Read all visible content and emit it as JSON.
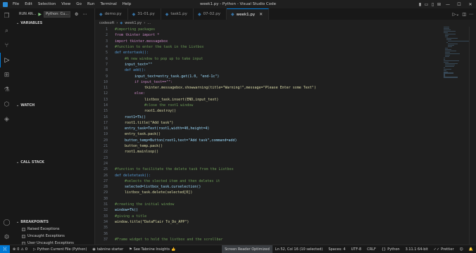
{
  "titlebar": {
    "title": "week1.py - Python - Visual Studio Code",
    "menu": [
      "File",
      "Edit",
      "Selection",
      "View",
      "Go",
      "Run",
      "Terminal",
      "Help"
    ],
    "min": "—",
    "max": "☐",
    "close": "✕"
  },
  "sidebar": {
    "run_label": "RUN AN...",
    "config": "Python: Cu...",
    "variables": "VARIABLES",
    "watch": "WATCH",
    "call_stack": "CALL STACK",
    "breakpoints": "BREAKPOINTS",
    "bp_items": [
      {
        "label": "Raised Exceptions"
      },
      {
        "label": "Uncaught Exceptions"
      },
      {
        "label": "User Uncaught Exceptions"
      }
    ]
  },
  "tabs": [
    {
      "label": "demo.py",
      "active": false
    },
    {
      "label": "31-01.py",
      "active": false
    },
    {
      "label": "task1.py",
      "active": false
    },
    {
      "label": "07-02.py",
      "active": false
    },
    {
      "label": "week1.py",
      "active": true
    }
  ],
  "breadcrumb": {
    "folder": "codesoft",
    "file": "week1.py",
    "tail": "..."
  },
  "code": [
    {
      "n": "1",
      "t": "#importing packages",
      "c": "comment",
      "i": 1
    },
    {
      "n": "2",
      "t": "from tkinter import *",
      "c": "kw",
      "i": 1
    },
    {
      "n": "3",
      "t": "import tkinter.messagebox",
      "c": "kw",
      "i": 1
    },
    {
      "n": "4",
      "t": "#function to enter the task in the Listbox",
      "c": "comment",
      "i": 1
    },
    {
      "n": "5",
      "t": "def entertask():",
      "c": "def",
      "i": 1
    },
    {
      "n": "6",
      "t": "#A new window to pop up to take input",
      "c": "comment",
      "i": 2
    },
    {
      "n": "7",
      "t": "input_text=\"\"",
      "c": "var",
      "i": 2
    },
    {
      "n": "8",
      "t": "def add():",
      "c": "def",
      "i": 2
    },
    {
      "n": "9",
      "t": "input_text=entry_task.get(1.0, \"end-1c\")",
      "c": "var",
      "i": 3
    },
    {
      "n": "10",
      "t": "if input_text==\"\":",
      "c": "kw",
      "i": 3
    },
    {
      "n": "11",
      "t": "tkinter.messagebox.showwarning(title=\"Warning!\",message=\"Please Enter some Text\")",
      "c": "call",
      "i": 4
    },
    {
      "n": "12",
      "t": "else:",
      "c": "kw",
      "i": 3
    },
    {
      "n": "13",
      "t": "listbox_task.insert(END,input_text)",
      "c": "call",
      "i": 4
    },
    {
      "n": "14",
      "t": "#close the root1 window",
      "c": "comment",
      "i": 4
    },
    {
      "n": "15",
      "t": "root1.destroy()",
      "c": "call",
      "i": 4
    },
    {
      "n": "16",
      "t": "root1=Tk()",
      "c": "var",
      "i": 2
    },
    {
      "n": "17",
      "t": "root1.title(\"Add task\")",
      "c": "call",
      "i": 2
    },
    {
      "n": "18",
      "t": "entry_task=Text(root1,width=40,height=4)",
      "c": "var",
      "i": 2
    },
    {
      "n": "19",
      "t": "entry_task.pack()",
      "c": "call",
      "i": 2
    },
    {
      "n": "20",
      "t": "button_temp=Button(root1,text=\"Add task\",command=add)",
      "c": "var",
      "i": 2
    },
    {
      "n": "21",
      "t": "button_temp.pack()",
      "c": "call",
      "i": 2
    },
    {
      "n": "22",
      "t": "root1.mainloop()",
      "c": "call",
      "i": 2
    },
    {
      "n": "23",
      "t": "",
      "c": "var",
      "i": 1
    },
    {
      "n": "24",
      "t": "",
      "c": "var",
      "i": 1
    },
    {
      "n": "25",
      "t": "#function to facilitate the delete task from the Listbox",
      "c": "comment",
      "i": 1
    },
    {
      "n": "26",
      "t": "def deletetask():",
      "c": "def",
      "i": 1
    },
    {
      "n": "27",
      "t": "#selects the slected item and then deletes it",
      "c": "comment",
      "i": 2
    },
    {
      "n": "28",
      "t": "selected=listbox_task.curselection()",
      "c": "var",
      "i": 2
    },
    {
      "n": "29",
      "t": "listbox_task.delete(selected[0])",
      "c": "call",
      "i": 2
    },
    {
      "n": "30",
      "t": "",
      "c": "var",
      "i": 1
    },
    {
      "n": "31",
      "t": "#creating the initial window",
      "c": "comment",
      "i": 1
    },
    {
      "n": "32",
      "t": "window=Tk()",
      "c": "var",
      "i": 1
    },
    {
      "n": "33",
      "t": "#giving a title",
      "c": "comment",
      "i": 1
    },
    {
      "n": "34",
      "t": "window.title(\"DataFlair To_Do_APP\")",
      "c": "call",
      "i": 1
    },
    {
      "n": "35",
      "t": "",
      "c": "var",
      "i": 1
    },
    {
      "n": "36",
      "t": "",
      "c": "var",
      "i": 1
    },
    {
      "n": "37",
      "t": "#Frame widget to hold the listbox and the scrollbar",
      "c": "comment",
      "i": 1
    }
  ],
  "status": {
    "interpreter": "Python Current File (Python)",
    "tabnine": "tabnine starter",
    "insights": "See Tabnine Insights",
    "screen_reader": "Screen Reader Optimized",
    "position": "Ln 52, Col 16 (10 selected)",
    "spaces": "Spaces: 4",
    "encoding": "UTF-8",
    "eol": "CRLF",
    "language": "Python",
    "version": "3.11.1 64-bit",
    "prettier": "Prettier"
  },
  "colors": {
    "accent": "#0078d4",
    "comment": "#6a9955",
    "keyword": "#c586c0",
    "def": "#569cd6",
    "string": "#ce9178",
    "var": "#9cdcfe",
    "func": "#dcdcaa"
  }
}
